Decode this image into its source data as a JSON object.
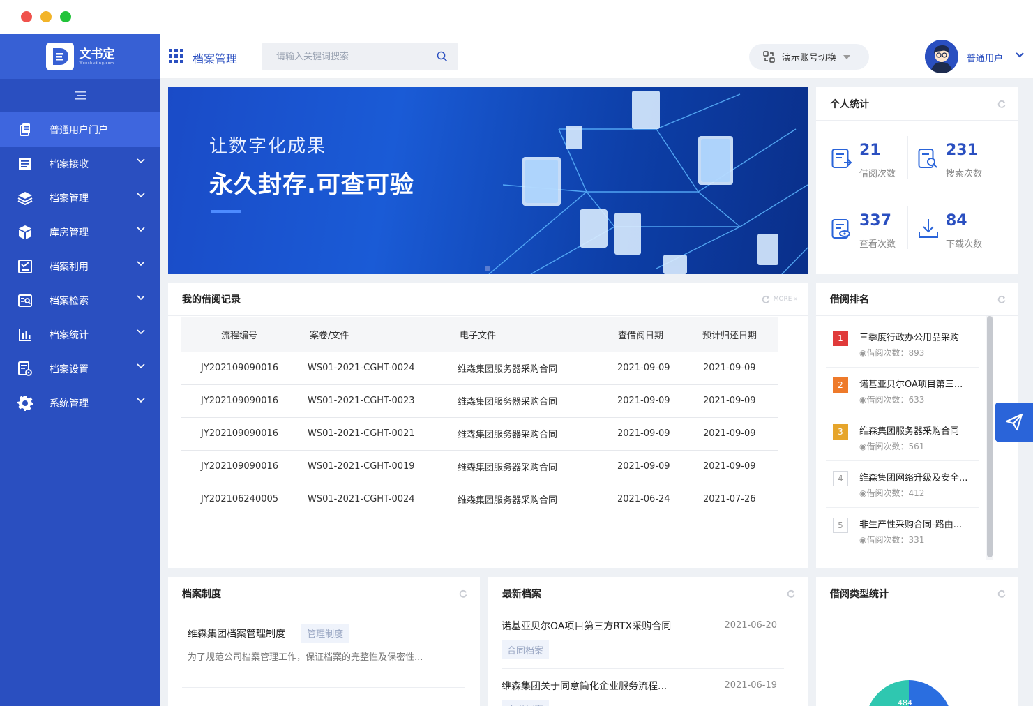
{
  "app": {
    "logo_cn": "文书定",
    "logo_en": "Wenshuding.com"
  },
  "sidebar": {
    "items": [
      {
        "label": "普通用户门户",
        "icon": "portal-icon"
      },
      {
        "label": "档案接收",
        "icon": "receive-icon"
      },
      {
        "label": "档案管理",
        "icon": "layers-icon"
      },
      {
        "label": "库房管理",
        "icon": "box-icon"
      },
      {
        "label": "档案利用",
        "icon": "checklist-icon"
      },
      {
        "label": "档案检索",
        "icon": "search-doc-icon"
      },
      {
        "label": "档案统计",
        "icon": "bar-chart-icon"
      },
      {
        "label": "档案设置",
        "icon": "doc-settings-icon"
      },
      {
        "label": "系统管理",
        "icon": "gear-icon"
      }
    ]
  },
  "topbar": {
    "module_title": "档案管理",
    "search_placeholder": "请输入关键词搜索",
    "account_switch": "演示账号切换",
    "user_name": "普通用户"
  },
  "banner": {
    "line1": "让数字化成果",
    "line2": "永久封存.可查可验"
  },
  "personal_stats": {
    "title": "个人统计",
    "items": [
      {
        "value": "21",
        "label": "借阅次数"
      },
      {
        "value": "231",
        "label": "搜索次数"
      },
      {
        "value": "337",
        "label": "查看次数"
      },
      {
        "value": "84",
        "label": "下载次数"
      }
    ]
  },
  "borrow_records": {
    "title": "我的借阅记录",
    "more": "MORE",
    "columns": [
      "流程编号",
      "案卷/文件",
      "电子文件",
      "查借阅日期",
      "预计归还日期"
    ],
    "rows": [
      [
        "JY202109090016",
        "WS01-2021-CGHT-0024",
        "维森集团服务器采购合同",
        "2021-09-09",
        "2021-09-09"
      ],
      [
        "JY202109090016",
        "WS01-2021-CGHT-0023",
        "维森集团服务器采购合同",
        "2021-09-09",
        "2021-09-09"
      ],
      [
        "JY202109090016",
        "WS01-2021-CGHT-0021",
        "维森集团服务器采购合同",
        "2021-09-09",
        "2021-09-09"
      ],
      [
        "JY202109090016",
        "WS01-2021-CGHT-0019",
        "维森集团服务器采购合同",
        "2021-09-09",
        "2021-09-09"
      ],
      [
        "JY202106240005",
        "WS01-2021-CGHT-0024",
        "维森集团服务器采购合同",
        "2021-06-24",
        "2021-07-26"
      ]
    ]
  },
  "ranking": {
    "title": "借阅排名",
    "items": [
      {
        "rank": "1",
        "title": "三季度行政办公用品采购",
        "count": "借阅次数：893",
        "color": "#e03a3a"
      },
      {
        "rank": "2",
        "title": "诺基亚贝尔OA项目第三...",
        "count": "借阅次数：633",
        "color": "#ee7a2a"
      },
      {
        "rank": "3",
        "title": "维森集团服务器采购合同",
        "count": "借阅次数：561",
        "color": "#e6a52b"
      },
      {
        "rank": "4",
        "title": "维森集团网络升级及安全...",
        "count": "借阅次数：412",
        "color": ""
      },
      {
        "rank": "5",
        "title": "非生产性采购合同-路由...",
        "count": "借阅次数：331",
        "color": ""
      }
    ]
  },
  "policy": {
    "title": "档案制度",
    "item_title": "维森集团档案管理制度",
    "item_tag": "管理制度",
    "item_desc": "为了规范公司档案管理工作，保证档案的完整性及保密性..."
  },
  "latest": {
    "title": "最新档案",
    "items": [
      {
        "title": "诺基亚贝尔OA项目第三方RTX采购合同",
        "date": "2021-06-20",
        "tag": "合同档案"
      },
      {
        "title": "维森集团关于同意简化企业服务流程...",
        "date": "2021-06-19",
        "tag": "文书档案"
      }
    ]
  },
  "borrow_type": {
    "title": "借阅类型统计",
    "visible_value": "484"
  },
  "colors": {
    "sidebar": "#2a4fc0",
    "primary": "#2a4fc0",
    "accent": "#2a64d9"
  }
}
